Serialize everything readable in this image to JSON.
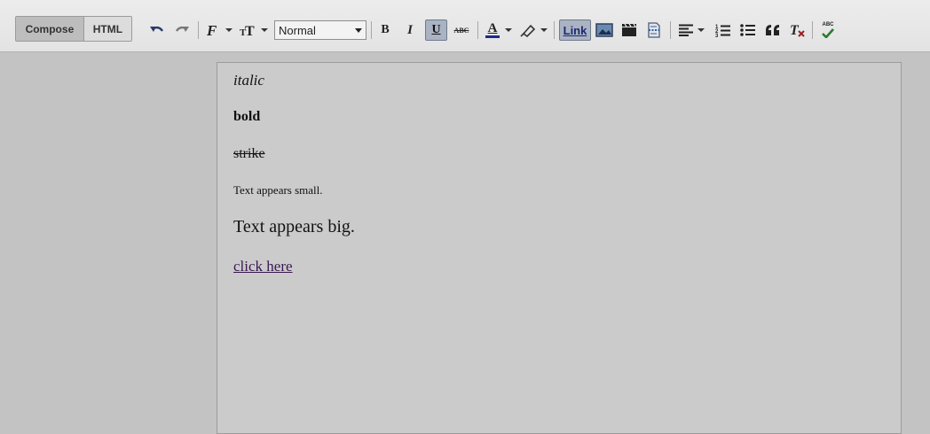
{
  "toolbar": {
    "compose_label": "Compose",
    "html_label": "HTML",
    "format_select": {
      "value": "Normal"
    },
    "bold_label": "B",
    "italic_label": "I",
    "underline_label": "U",
    "strikethrough_label": "ABC",
    "text_color_label": "A",
    "link_label": "Link",
    "spellcheck_label": "ABC",
    "icons": [
      "undo-icon",
      "redo-icon",
      "font-icon",
      "font-size-icon",
      "text-color-icon",
      "highlight-icon",
      "image-icon",
      "video-icon",
      "jump-break-icon",
      "align-icon",
      "numbered-list-icon",
      "bullet-list-icon",
      "quote-icon",
      "remove-formatting-icon",
      "spellcheck-icon"
    ]
  },
  "editor": {
    "lines": {
      "italic": "italic",
      "bold": "bold",
      "strike": "strike",
      "small": "Text appears small.",
      "big": "Text appears big.",
      "link": "click here"
    }
  }
}
